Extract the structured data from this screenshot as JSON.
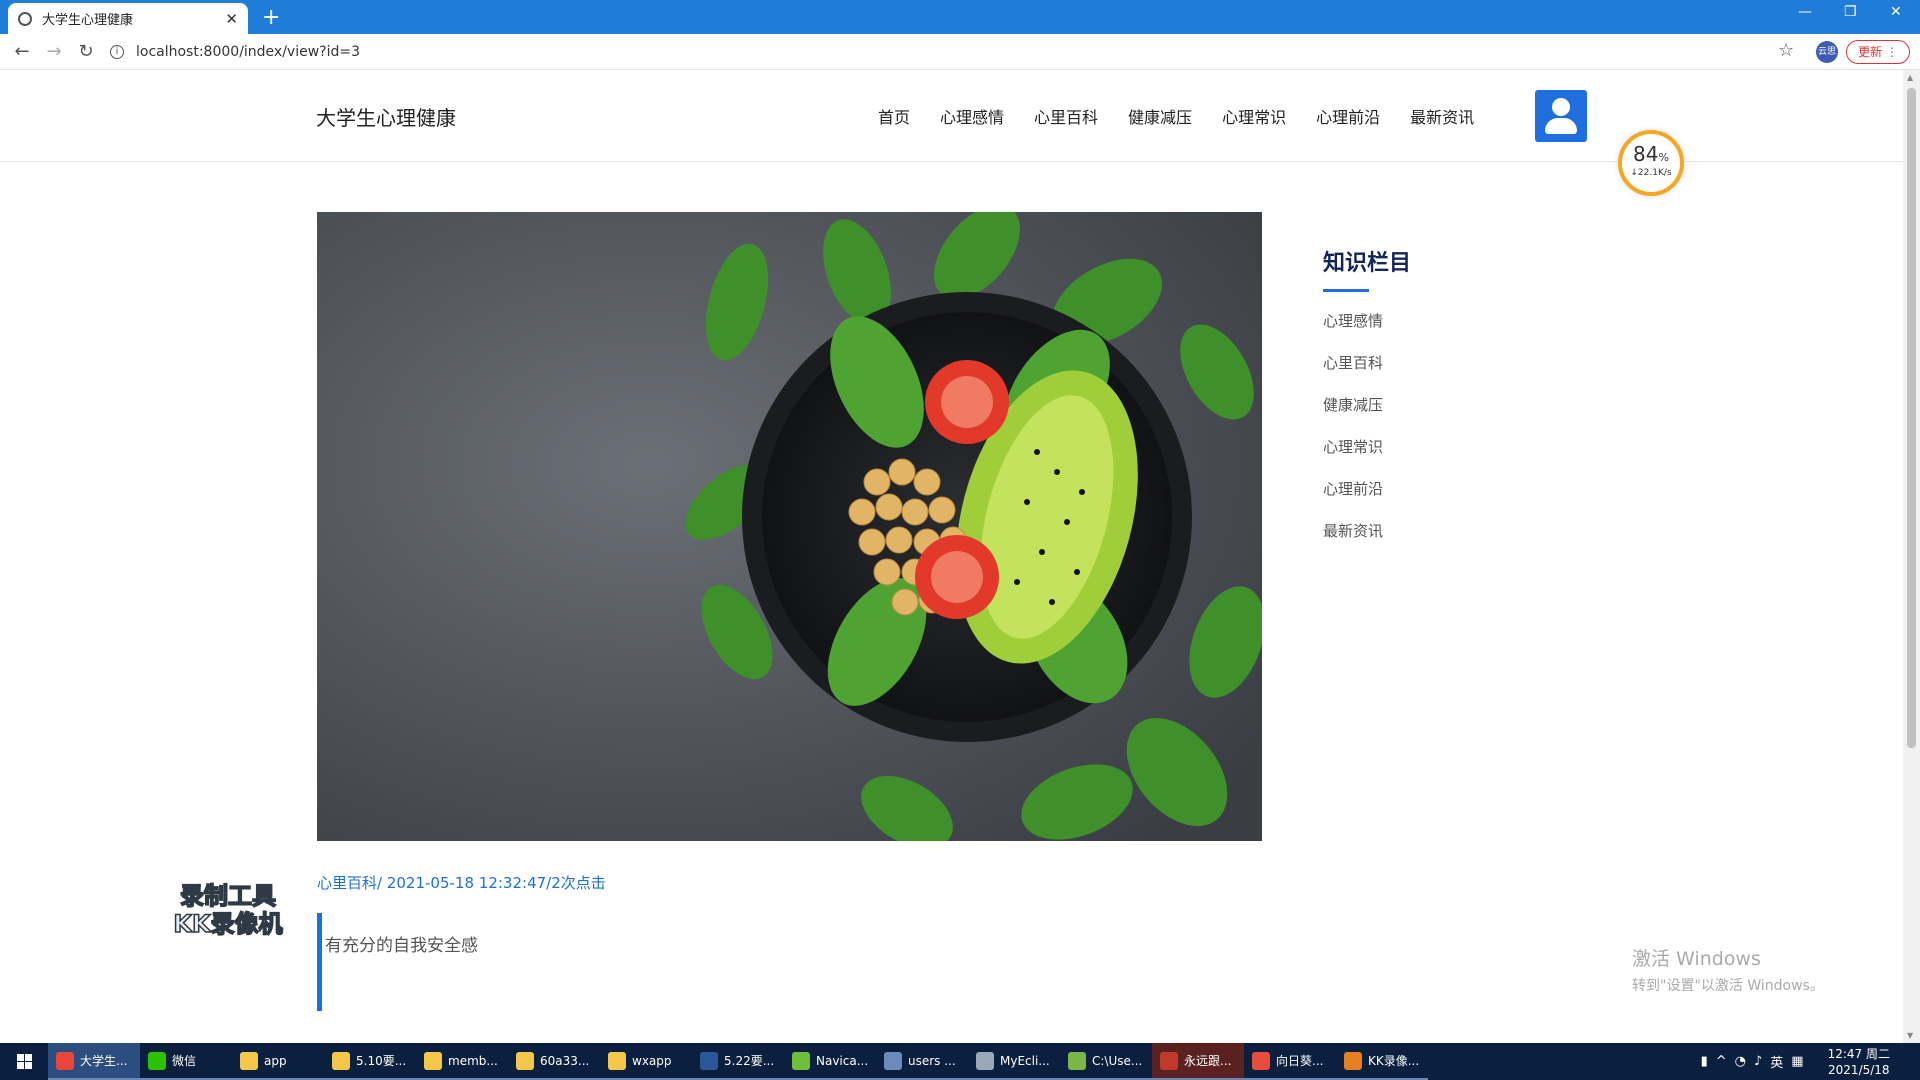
{
  "browser": {
    "tab_title": "大学生心理健康",
    "url": "localhost:8000/index/view?id=3",
    "profile_label": "云思",
    "update_label": "更新"
  },
  "site": {
    "title": "大学生心理健康",
    "nav": [
      "首页",
      "心理感情",
      "心里百科",
      "健康减压",
      "心理常识",
      "心理前沿",
      "最新资讯"
    ]
  },
  "speed_widget": {
    "percent": "84",
    "percent_unit": "%",
    "rate": "↓22.1K/s"
  },
  "article": {
    "category": "心里百科",
    "datetime": "2021-05-18 12:32:47",
    "clicks": "2次点击",
    "meta_separator": "/ ",
    "quote": "有充分的自我安全感"
  },
  "sidebar": {
    "title": "知识栏目",
    "items": [
      "心理感情",
      "心里百科",
      "健康减压",
      "心理常识",
      "心理前沿",
      "最新资讯"
    ]
  },
  "watermark": {
    "line1": "录制工具",
    "line2": "KK录像机"
  },
  "activate_windows": {
    "line1": "激活 Windows",
    "line2": "转到\"设置\"以激活 Windows。"
  },
  "taskbar": {
    "items": [
      {
        "label": "大学生...",
        "icon": "chrome-icon",
        "color": "#e8453c",
        "state": "active"
      },
      {
        "label": "微信",
        "icon": "wechat-icon",
        "color": "#2dc100",
        "state": ""
      },
      {
        "label": "app",
        "icon": "folder-icon",
        "color": "#f3c74a",
        "state": ""
      },
      {
        "label": "5.10要...",
        "icon": "folder-icon",
        "color": "#f3c74a",
        "state": ""
      },
      {
        "label": "memb...",
        "icon": "folder-icon",
        "color": "#f3c74a",
        "state": ""
      },
      {
        "label": "60a33...",
        "icon": "folder-icon",
        "color": "#f3c74a",
        "state": ""
      },
      {
        "label": "wxapp",
        "icon": "folder-icon",
        "color": "#f3c74a",
        "state": ""
      },
      {
        "label": "5.22要...",
        "icon": "word-icon",
        "color": "#2b579a",
        "state": ""
      },
      {
        "label": "Navica...",
        "icon": "navicat-icon",
        "color": "#6fbf3c",
        "state": ""
      },
      {
        "label": "users ...",
        "icon": "table-icon",
        "color": "#6b8bb8",
        "state": ""
      },
      {
        "label": "MyEcli...",
        "icon": "myeclipse-icon",
        "color": "#9aa7b8",
        "state": ""
      },
      {
        "label": "C:\\Use...",
        "icon": "notepad-icon",
        "color": "#7ab648",
        "state": ""
      },
      {
        "label": "永远跟...",
        "icon": "star-app-icon",
        "color": "#c0392b",
        "state": "active2"
      },
      {
        "label": "向日葵...",
        "icon": "sunflower-icon",
        "color": "#e84c3d",
        "state": ""
      },
      {
        "label": "KK录像...",
        "icon": "kk-recorder-icon",
        "color": "#e67e22",
        "state": ""
      }
    ],
    "ime": "英",
    "time": "12:47 周二",
    "date": "2021/5/18"
  }
}
